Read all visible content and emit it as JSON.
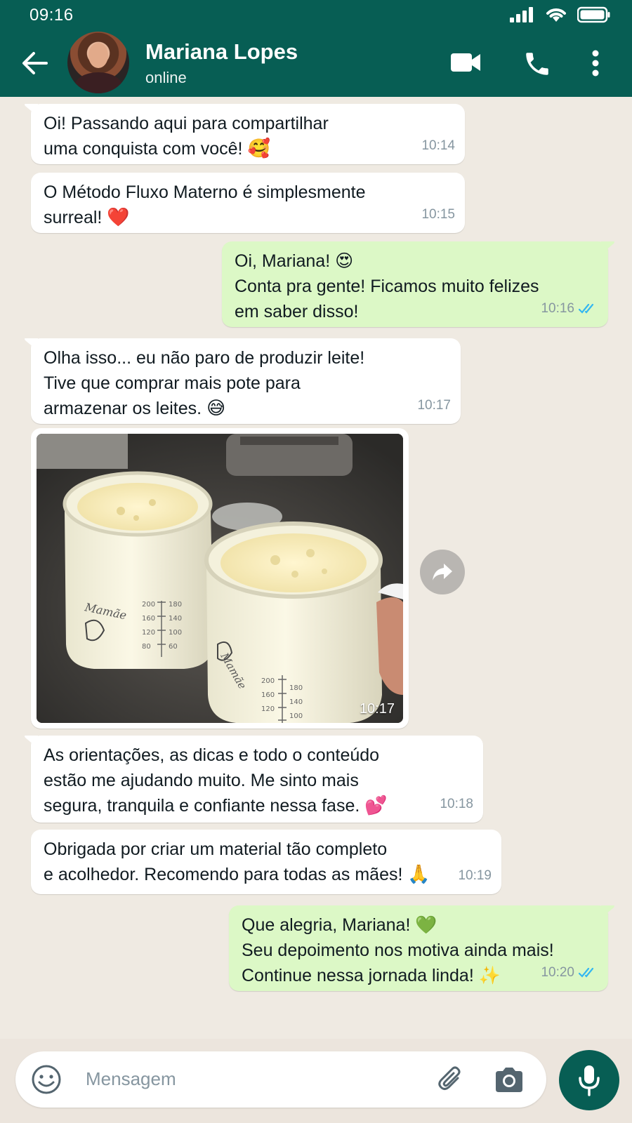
{
  "status_bar": {
    "time": "09:16"
  },
  "header": {
    "contact_name": "Mariana Lopes",
    "contact_status": "online"
  },
  "messages": [
    {
      "direction": "in",
      "text": "Oi! Passando aqui para compartilhar\numa conquista com você!",
      "emoji": "🥰",
      "time": "10:14"
    },
    {
      "direction": "in",
      "text": "O Método Fluxo Materno é simplesmente\nsurreal!",
      "emoji": "❤️",
      "time": "10:15"
    },
    {
      "direction": "out",
      "text": "Oi, Mariana! 😍\nConta pra gente! Ficamos muito felizes\nem saber disso!",
      "time": "10:16"
    },
    {
      "direction": "in",
      "text": "Olha isso... eu não paro de produzir leite!\nTive que comprar mais pote para\narmazenar os leites.",
      "emoji": "😅",
      "time": "10:17"
    },
    {
      "direction": "in",
      "type": "image",
      "time": "10:17"
    },
    {
      "direction": "in",
      "text": "As orientações, as dicas e todo o conteúdo\nestão me ajudando muito. Me sinto mais\nsegura, tranquila e confiante nessa fase.",
      "emoji": "💕",
      "time": "10:18"
    },
    {
      "direction": "in",
      "text": "Obrigada por criar um material tão completo\ne acolhedor. Recomendo para todas as mães!",
      "emoji": "🙏",
      "time": "10:19"
    },
    {
      "direction": "out",
      "text": "Que alegria, Mariana! 💚\nSeu depoimento nos motiva ainda mais!\nContinue nessa jornada linda! ✨",
      "time": "10:20"
    }
  ],
  "photo": {
    "jar_label": "Mamãe",
    "scale": [
      "200",
      "180",
      "160",
      "140",
      "120",
      "100",
      "80",
      "60"
    ]
  },
  "input": {
    "placeholder": "Mensagem"
  },
  "colors": {
    "header": "#075e54",
    "bubble_out": "#dcf8c6",
    "bubble_in": "#ffffff",
    "read_tick": "#34b7f1",
    "chat_bg": "#efeae2"
  },
  "icons": [
    "back-arrow-icon",
    "video-call-icon",
    "phone-icon",
    "more-vert-icon",
    "signal-icon",
    "wifi-icon",
    "battery-icon",
    "forward-icon",
    "emoji-icon",
    "attach-icon",
    "camera-icon",
    "mic-icon",
    "double-check-icon"
  ]
}
